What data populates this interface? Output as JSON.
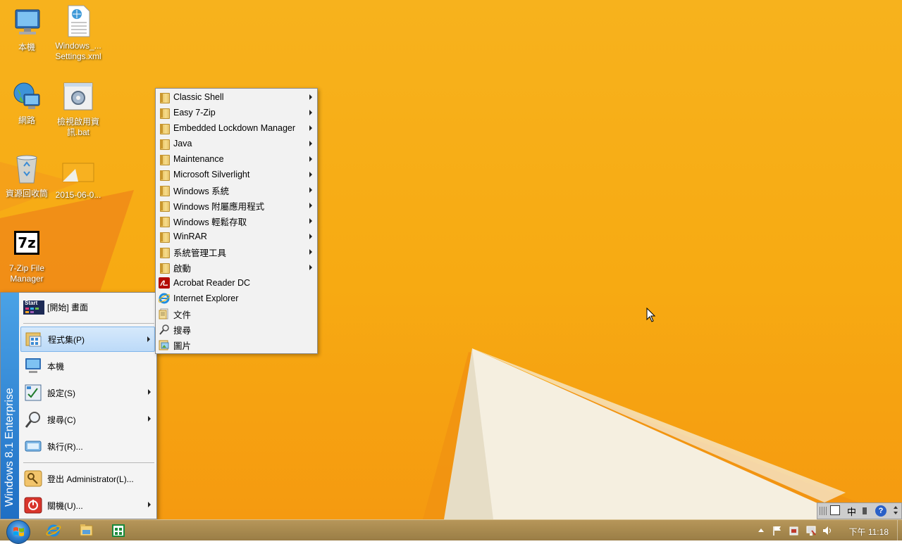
{
  "desktop": {
    "icons": [
      {
        "label": "本機"
      },
      {
        "label": "Windows_...\nSettings.xml"
      },
      {
        "label": "網路"
      },
      {
        "label": "檢視啟用資\n訊.bat"
      },
      {
        "label": "資源回收筒"
      },
      {
        "label": "2015-06-0..."
      },
      {
        "label": "7-Zip File\nManager"
      }
    ],
    "zip_logo": "7z"
  },
  "start_menu": {
    "banner": "Windows 8.1 Enterprise",
    "items": [
      {
        "label": "[開始] 畫面",
        "badge": "Start"
      },
      {
        "label": "程式集(P)"
      },
      {
        "label": "本機"
      },
      {
        "label": "設定(S)"
      },
      {
        "label": "搜尋(C)"
      },
      {
        "label": "執行(R)..."
      },
      {
        "label": "登出 Administrator(L)..."
      },
      {
        "label": "關機(U)..."
      }
    ]
  },
  "programs_menu": {
    "items": [
      {
        "label": "Classic Shell"
      },
      {
        "label": "Easy 7-Zip"
      },
      {
        "label": "Embedded Lockdown Manager"
      },
      {
        "label": "Java"
      },
      {
        "label": "Maintenance"
      },
      {
        "label": "Microsoft Silverlight"
      },
      {
        "label": "Windows 系統"
      },
      {
        "label": "Windows 附屬應用程式"
      },
      {
        "label": "Windows 輕鬆存取"
      },
      {
        "label": "WinRAR"
      },
      {
        "label": "系統管理工具"
      },
      {
        "label": "啟動"
      },
      {
        "label": "Acrobat Reader DC"
      },
      {
        "label": "Internet Explorer"
      },
      {
        "label": "文件"
      },
      {
        "label": "搜尋"
      },
      {
        "label": "圖片"
      }
    ]
  },
  "taskbar": {
    "clock": "下午 11:18",
    "lang_indicator": "中"
  },
  "colors": {
    "desktop_bg": "#f7aa12",
    "banner_blue": "#2a7fd4",
    "taskbar": "#a88a4f"
  }
}
